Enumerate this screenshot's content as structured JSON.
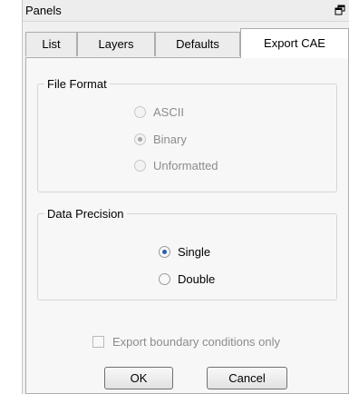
{
  "panel": {
    "title": "Panels"
  },
  "tabs": [
    {
      "label": "List"
    },
    {
      "label": "Layers"
    },
    {
      "label": "Defaults"
    },
    {
      "label": "Export CAE",
      "active": true
    }
  ],
  "file_format": {
    "legend": "File Format",
    "enabled": false,
    "options": [
      {
        "label": "ASCII",
        "checked": false
      },
      {
        "label": "Binary",
        "checked": true
      },
      {
        "label": "Unformatted",
        "checked": false
      }
    ]
  },
  "data_precision": {
    "legend": "Data Precision",
    "enabled": true,
    "options": [
      {
        "label": "Single",
        "checked": true
      },
      {
        "label": "Double",
        "checked": false
      }
    ]
  },
  "export_boundary": {
    "label": "Export boundary conditions only",
    "checked": false,
    "enabled": false
  },
  "buttons": {
    "ok": "OK",
    "cancel": "Cancel"
  },
  "icons": {
    "restore": "restore-window-icon"
  },
  "colors": {
    "radio_selected": "#2a5fb0",
    "disabled_text": "#8c8c8c"
  }
}
